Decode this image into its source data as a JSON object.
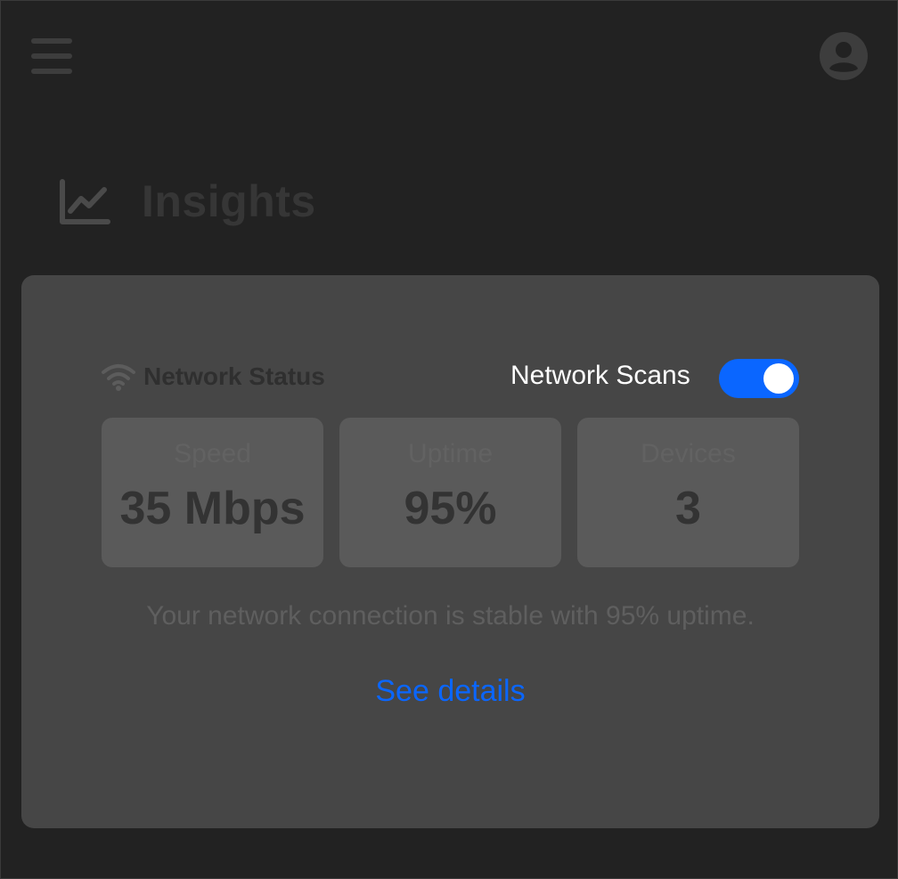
{
  "header": {
    "menu_icon": "hamburger-menu-icon",
    "account_icon": "account-circle-icon"
  },
  "page": {
    "title": "Insights",
    "title_icon": "line-chart-icon"
  },
  "card": {
    "section_title": "Network Status",
    "section_icon": "wifi-icon",
    "toggle": {
      "label": "Network Scans",
      "enabled": true
    },
    "stats": [
      {
        "label": "Speed",
        "value": "35 Mbps"
      },
      {
        "label": "Uptime",
        "value": "95%"
      },
      {
        "label": "Devices",
        "value": "3"
      }
    ],
    "summary": "Your network connection is stable with 95% uptime.",
    "details_link": "See details"
  },
  "colors": {
    "background": "#222222",
    "card": "#464646",
    "stat_tile": "#5a5a5a",
    "accent": "#0a66ff"
  }
}
